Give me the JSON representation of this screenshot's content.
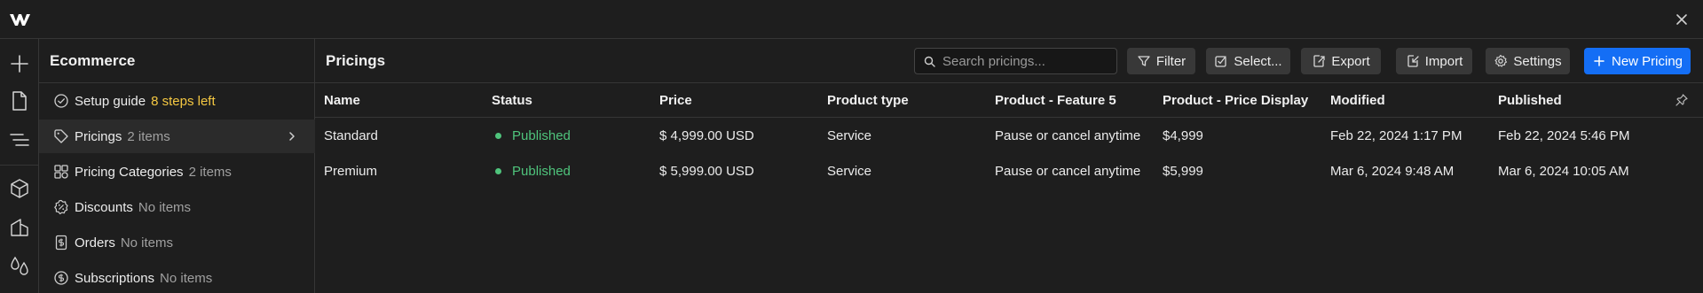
{
  "app": {
    "logo": "webflow-logo"
  },
  "sidebar": {
    "title": "Ecommerce",
    "items": [
      {
        "label": "Setup guide",
        "count": "8 steps left",
        "icon": "check-circle-icon"
      },
      {
        "label": "Pricings",
        "count": "2 items",
        "icon": "tag-icon",
        "active": true
      },
      {
        "label": "Pricing Categories",
        "count": "2 items",
        "icon": "categories-icon"
      },
      {
        "label": "Discounts",
        "count": "No items",
        "icon": "discount-badge-icon"
      },
      {
        "label": "Orders",
        "count": "No items",
        "icon": "receipt-icon"
      },
      {
        "label": "Subscriptions",
        "count": "No items",
        "icon": "dollar-cycle-icon"
      }
    ]
  },
  "main": {
    "title": "Pricings",
    "search_placeholder": "Search pricings...",
    "toolbar": {
      "filter": "Filter",
      "select": "Select...",
      "export": "Export",
      "import": "Import",
      "settings": "Settings",
      "new": "New Pricing"
    },
    "columns": [
      "Name",
      "Status",
      "Price",
      "Product type",
      "Product - Feature 5",
      "Product - Price Display",
      "Modified",
      "Published"
    ],
    "rows": [
      {
        "name": "Standard",
        "status": "Published",
        "price": "$ 4,999.00 USD",
        "product_type": "Service",
        "feature5": "Pause or cancel anytime",
        "price_display": "$4,999",
        "modified": "Feb 22, 2024 1:17 PM",
        "published": "Feb 22, 2024 5:46 PM"
      },
      {
        "name": "Premium",
        "status": "Published",
        "price": "$ 5,999.00 USD",
        "product_type": "Service",
        "feature5": "Pause or cancel anytime",
        "price_display": "$5,999",
        "modified": "Mar 6, 2024 9:48 AM",
        "published": "Mar 6, 2024 10:05 AM"
      }
    ]
  },
  "colors": {
    "accent": "#146ef5",
    "published": "#4fc47c",
    "warning": "#f5c842",
    "background": "#1e1e1e"
  }
}
